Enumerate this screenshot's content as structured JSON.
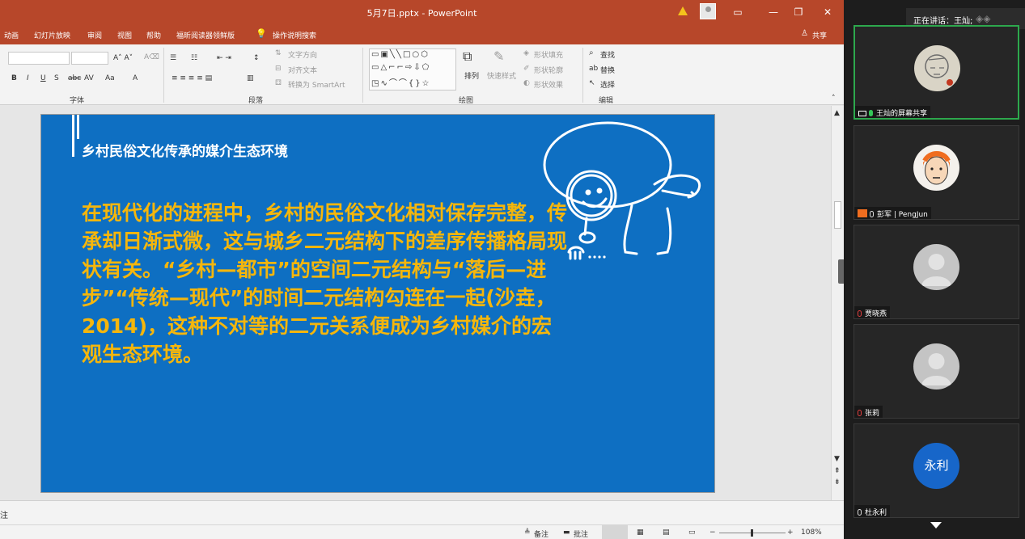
{
  "window": {
    "title": "5月7日.pptx  -  PowerPoint",
    "share_label": "共享"
  },
  "menu": {
    "items": [
      "动画",
      "幻灯片放映",
      "审阅",
      "视图",
      "帮助",
      "福昕阅读器领鲜版"
    ],
    "tell_me": "操作说明搜索"
  },
  "ribbon": {
    "font_group": "字体",
    "paragraph_group": "段落",
    "drawing_group": "绘图",
    "editing_group": "编辑",
    "text_direction": "文字方向",
    "align_text": "对齐文本",
    "convert_smartart": "转换为 SmartArt",
    "arrange": "排列",
    "quick_styles": "快速样式",
    "shape_fill": "形状填充",
    "shape_outline": "形状轮廓",
    "shape_effects": "形状效果",
    "find": "查找",
    "replace": "替换",
    "select": "选择"
  },
  "slide": {
    "title": "乡村民俗文化传承的媒介生态环境",
    "body": "在现代化的进程中，乡村的民俗文化相对保存完整，传承却日渐式微，这与城乡二元结构下的差序传播格局现状有关。“乡村—都市”的空间二元结构与“落后—进步”“传统—现代”的时间二元结构勾连在一起(沙垚，2014)，这种不对等的二元关系便成为乡村媒介的宏观生态环境。"
  },
  "notes_label": "注",
  "status": {
    "notes": "备注",
    "comments": "批注",
    "zoom": "108%"
  },
  "meeting": {
    "speaking": "正在讲话：王灿;",
    "participants": [
      {
        "name": "王灿的屏幕共享",
        "type": "screen"
      },
      {
        "name": "彭军 | PengJun",
        "type": "photo"
      },
      {
        "name": "贾晓燕",
        "type": "default"
      },
      {
        "name": "张莉",
        "type": "default"
      },
      {
        "name": "杜永利",
        "type": "initials",
        "initials": "永利"
      }
    ]
  },
  "colors": {
    "ppt_accent": "#b7472a",
    "slide_bg": "#0e6fc2",
    "body_text": "#f5b60c",
    "active_border": "#2da84d"
  }
}
